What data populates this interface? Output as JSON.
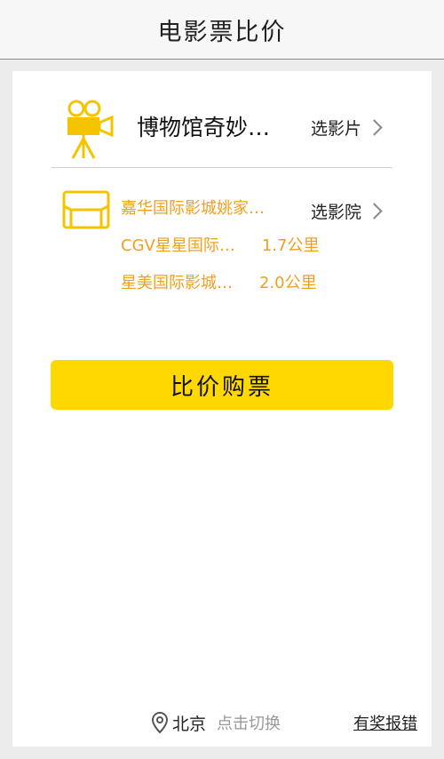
{
  "header": {
    "title": "电影票比价"
  },
  "movie": {
    "title": "博物馆奇妙…",
    "pick_label": "选影片"
  },
  "cinema": {
    "pick_label": "选影院",
    "items": [
      {
        "name": "嘉华国际影城姚家…",
        "distance": ""
      },
      {
        "name": "CGV星星国际…",
        "distance": "1.7公里"
      },
      {
        "name": "星美国际影城…",
        "distance": "2.0公里"
      }
    ]
  },
  "cta": {
    "label": "比价购票"
  },
  "footer": {
    "city": "北京",
    "switch_label": "点击切换",
    "report_label": "有奖报错"
  },
  "colors": {
    "accent": "#fed800",
    "icon": "#f5c400",
    "cinema_text": "#f0a020"
  },
  "icons": {
    "movie": "movie-camera-icon",
    "cinema": "sofa-icon",
    "location": "location-pin-icon"
  }
}
